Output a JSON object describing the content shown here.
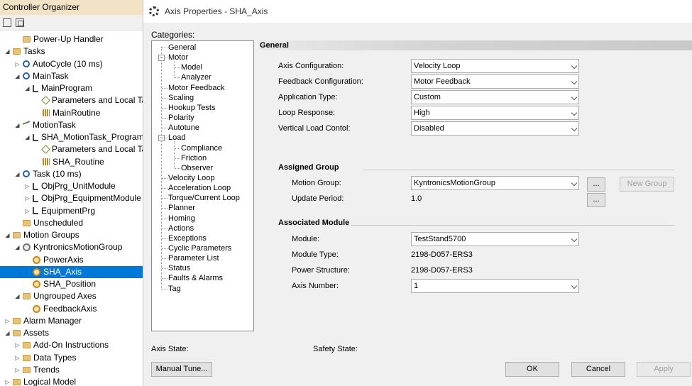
{
  "organizer": {
    "title": "Controller Organizer",
    "tree": [
      {
        "label": "Power-Up Handler",
        "icon": "folder",
        "exp": "",
        "indent": 2
      },
      {
        "label": "Tasks",
        "icon": "folder",
        "exp": "◢",
        "indent": 1
      },
      {
        "label": "AutoCycle (10 ms)",
        "icon": "clock",
        "exp": "▷",
        "indent": 2
      },
      {
        "label": "MainTask",
        "icon": "clock",
        "exp": "◢",
        "indent": 2
      },
      {
        "label": "MainProgram",
        "icon": "prog",
        "exp": "◢",
        "indent": 3
      },
      {
        "label": "Parameters and Local Tags",
        "icon": "tag",
        "exp": "",
        "indent": 4
      },
      {
        "label": "MainRoutine",
        "icon": "routine",
        "exp": "",
        "indent": 4
      },
      {
        "label": "MotionTask",
        "icon": "motion",
        "exp": "◢",
        "indent": 2
      },
      {
        "label": "SHA_MotionTask_Program",
        "icon": "prog",
        "exp": "◢",
        "indent": 3
      },
      {
        "label": "Parameters and Local Tags",
        "icon": "tag",
        "exp": "",
        "indent": 4
      },
      {
        "label": "SHA_Routine",
        "icon": "routine",
        "exp": "",
        "indent": 4
      },
      {
        "label": "Task (10 ms)",
        "icon": "clock",
        "exp": "◢",
        "indent": 2
      },
      {
        "label": "ObjPrg_UnitModule",
        "icon": "prog",
        "exp": "▷",
        "indent": 3
      },
      {
        "label": "ObjPrg_EquipmentModule",
        "icon": "prog",
        "exp": "▷",
        "indent": 3
      },
      {
        "label": "EquipmentPrg",
        "icon": "prog",
        "exp": "▷",
        "indent": 3
      },
      {
        "label": "Unscheduled",
        "icon": "folder",
        "exp": "",
        "indent": 2
      },
      {
        "label": "Motion Groups",
        "icon": "folder",
        "exp": "◢",
        "indent": 1
      },
      {
        "label": "KyntronicsMotionGroup",
        "icon": "group",
        "exp": "◢",
        "indent": 2
      },
      {
        "label": "PowerAxis",
        "icon": "axis",
        "exp": "",
        "indent": 3
      },
      {
        "label": "SHA_Axis",
        "icon": "axis",
        "exp": "",
        "indent": 3,
        "selected": true
      },
      {
        "label": "SHA_Position",
        "icon": "axis",
        "exp": "",
        "indent": 3
      },
      {
        "label": "Ungrouped Axes",
        "icon": "folder",
        "exp": "◢",
        "indent": 2
      },
      {
        "label": "FeedbackAxis",
        "icon": "axis",
        "exp": "",
        "indent": 3
      },
      {
        "label": "Alarm Manager",
        "icon": "folder",
        "exp": "▷",
        "indent": 1
      },
      {
        "label": "Assets",
        "icon": "folder",
        "exp": "◢",
        "indent": 1
      },
      {
        "label": "Add-On Instructions",
        "icon": "folder",
        "exp": "▷",
        "indent": 2
      },
      {
        "label": "Data Types",
        "icon": "folder",
        "exp": "▷",
        "indent": 2
      },
      {
        "label": "Trends",
        "icon": "folder",
        "exp": "▷",
        "indent": 2
      },
      {
        "label": "Logical Model",
        "icon": "folder",
        "exp": "▷",
        "indent": 1
      }
    ]
  },
  "dialog": {
    "title": "Axis Properties - SHA_Axis",
    "categories_label": "Categories:",
    "categories": [
      {
        "label": "General",
        "level": 0
      },
      {
        "label": "Motor",
        "level": 0,
        "minus": true
      },
      {
        "label": "Model",
        "level": 1
      },
      {
        "label": "Analyzer",
        "level": 1
      },
      {
        "label": "Motor Feedback",
        "level": 0
      },
      {
        "label": "Scaling",
        "level": 0
      },
      {
        "label": "Hookup Tests",
        "level": 0
      },
      {
        "label": "Polarity",
        "level": 0
      },
      {
        "label": "Autotune",
        "level": 0
      },
      {
        "label": "Load",
        "level": 0,
        "minus": true
      },
      {
        "label": "Compliance",
        "level": 1
      },
      {
        "label": "Friction",
        "level": 1
      },
      {
        "label": "Observer",
        "level": 1
      },
      {
        "label": "Velocity Loop",
        "level": 0
      },
      {
        "label": "Acceleration Loop",
        "level": 0
      },
      {
        "label": "Torque/Current Loop",
        "level": 0
      },
      {
        "label": "Planner",
        "level": 0
      },
      {
        "label": "Homing",
        "level": 0
      },
      {
        "label": "Actions",
        "level": 0
      },
      {
        "label": "Exceptions",
        "level": 0
      },
      {
        "label": "Cyclic Parameters",
        "level": 0
      },
      {
        "label": "Parameter List",
        "level": 0
      },
      {
        "label": "Status",
        "level": 0
      },
      {
        "label": "Faults & Alarms",
        "level": 0
      },
      {
        "label": "Tag",
        "level": 0
      }
    ],
    "general_header": "General",
    "axis_configuration_label": "Axis Configuration:",
    "axis_configuration_value": "Velocity Loop",
    "feedback_configuration_label": "Feedback Configuration:",
    "feedback_configuration_value": "Motor Feedback",
    "application_type_label": "Application Type:",
    "application_type_value": "Custom",
    "loop_response_label": "Loop Response:",
    "loop_response_value": "High",
    "vertical_load_label": "Vertical Load Contol:",
    "vertical_load_value": "Disabled",
    "assigned_group_title": "Assigned Group",
    "motion_group_label": "Motion Group:",
    "motion_group_value": "KyntronicsMotionGroup",
    "ellipsis": "...",
    "new_group_label": "New Group",
    "update_period_label": "Update Period:",
    "update_period_value": "1.0",
    "associated_module_title": "Associated Module",
    "module_label": "Module:",
    "module_value": "TestStand5700",
    "module_type_label": "Module Type:",
    "module_type_value": "2198-D057-ERS3",
    "power_structure_label": "Power Structure:",
    "power_structure_value": "2198-D057-ERS3",
    "axis_number_label": "Axis Number:",
    "axis_number_value": "1",
    "axis_state_label": "Axis State:",
    "safety_state_label": "Safety State:",
    "manual_tune_label": "Manual Tune...",
    "ok_label": "OK",
    "cancel_label": "Cancel",
    "apply_label": "Apply"
  }
}
